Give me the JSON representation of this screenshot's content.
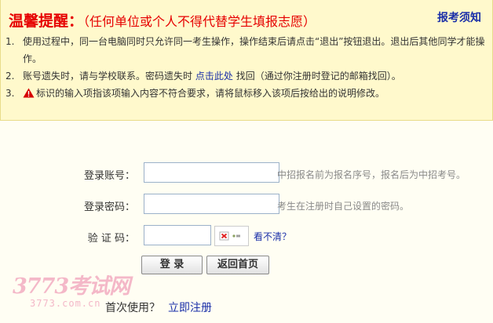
{
  "notice": {
    "title": "温馨提醒：",
    "subtitle": "（任何单位或个人不得代替学生填报志愿）",
    "guide_link": "报考须知",
    "items": [
      {
        "num": "1.",
        "text": "使用过程中，同一台电脑同时只允许同一考生操作，操作结束后请点击“退出”按钮退出。退出后其他同学才能操作。"
      },
      {
        "num": "2.",
        "before": "账号遗失时，请与学校联系。密码遗失时",
        "link": "点击此处",
        "after": "找回（通过你注册时登记的邮箱找回）。"
      },
      {
        "num": "3.",
        "icon": "warning-icon",
        "text": "标识的输入项指该项输入内容不符合要求，请将鼠标移入该项后按给出的说明修改。"
      }
    ]
  },
  "form": {
    "account": {
      "label": "登录账号：",
      "value": "",
      "hint": "中招报名前为报名序号，报名后为中招考号。"
    },
    "password": {
      "label": "登录密码：",
      "value": "",
      "hint": "考生在注册时自己设置的密码。"
    },
    "captcha": {
      "label": "验 证 码：",
      "value": "",
      "image_icon": "broken-image-icon",
      "refresh_link": "看不清？"
    },
    "login_button": "登 录",
    "home_button": "返回首页"
  },
  "watermark": {
    "main": "3773考试网",
    "sub": "3773.com.cn"
  },
  "signup": {
    "prompt": "首次使用？",
    "link": "立即注册"
  },
  "colors": {
    "notice_bg": "#fff9cc",
    "page_bg": "#fffef3",
    "title_red": "#e60000",
    "link_blue": "#1a2fa8",
    "hint_gray": "#8a8a8a",
    "input_border": "#9bb1c9",
    "watermark_pink": "#f4b8c8"
  }
}
